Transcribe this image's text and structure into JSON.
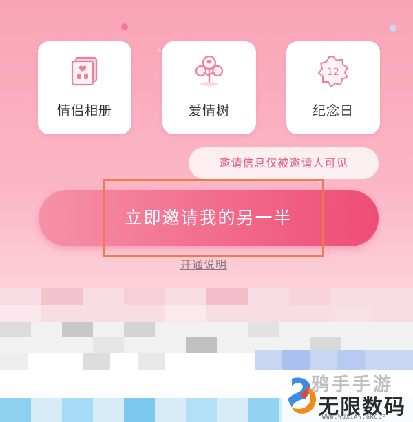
{
  "features": [
    {
      "label": "情侣相册",
      "icon": "photo-album-icon"
    },
    {
      "label": "爱情树",
      "icon": "love-tree-icon"
    },
    {
      "label": "纪念日",
      "icon": "anniversary-badge-icon",
      "badge": "12"
    }
  ],
  "tooltip": {
    "text": "邀请信息仅被邀请人可见"
  },
  "invite_button": {
    "label": "立即邀请我的另一半"
  },
  "explain_link": {
    "label": "开通说明"
  },
  "watermark": {
    "top_text": "鸦手手游",
    "main_text": "无限数码",
    "sub_text": "WWW.WUXIAN.GROUP"
  },
  "colors": {
    "accent": "#ee4d76",
    "highlight": "#f07b4a",
    "background_top": "#f9a3b6"
  }
}
